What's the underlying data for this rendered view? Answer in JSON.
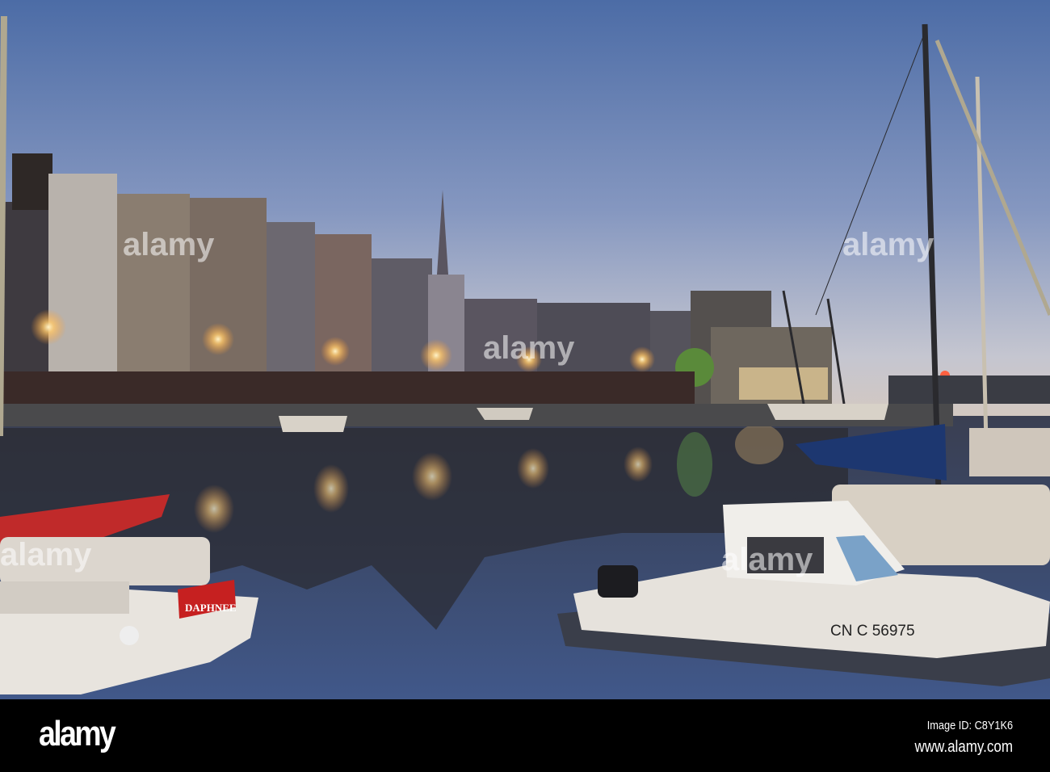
{
  "photo": {
    "boat_names": {
      "left_boat": "DAPHNEE",
      "motor_boat_registration": "CN C 56975"
    },
    "watermark": "alamy",
    "colors": {
      "sky_top": "#4f6fa8",
      "sky_horizon": "#c9c5c6",
      "water": "#2f3d5c",
      "lamp": "#ffd27a"
    }
  },
  "footer": {
    "logo": "alamy",
    "image_id": "Image ID: C8Y1K6",
    "website": "www.alamy.com"
  }
}
